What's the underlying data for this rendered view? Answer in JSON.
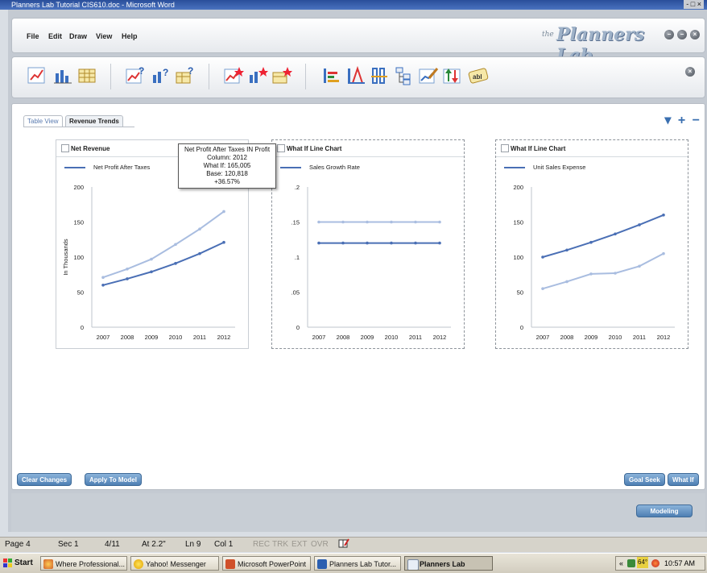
{
  "word_window": {
    "title": "Planners Lab Tutorial CIS610.doc - Microsoft Word",
    "controls": "- □ ×"
  },
  "app": {
    "menu": [
      "File",
      "Edit",
      "Draw",
      "View",
      "Help"
    ],
    "brand_prefix": "the",
    "brand_name": "Planners Lab",
    "window_buttons": [
      "−",
      "−",
      "×"
    ],
    "toolbar_icons": [
      "line-chart-icon",
      "bar-chart-icon",
      "table-icon",
      "line-chart-question-icon",
      "bar-chart-question-icon",
      "table-question-icon",
      "line-chart-star-icon",
      "bar-chart-star-icon",
      "table-star-icon",
      "bar-sort-icon",
      "range-icon",
      "column-split-icon",
      "tree-icon",
      "edit-chart-icon",
      "up-down-icon",
      "text-label-icon"
    ],
    "toolbar_close": "×",
    "tabs": [
      "Table View",
      "Revenue Trends"
    ],
    "tab_active": "Revenue Trends",
    "workspace_controls": "▾ + −",
    "buttons": {
      "clear": "Clear Changes",
      "apply": "Apply To Model",
      "goal_seek": "Goal Seek",
      "what_if": "What If",
      "modeling": "Modeling"
    }
  },
  "panels": [
    {
      "title": "Net Revenue",
      "legend": "Net Profit After Taxes"
    },
    {
      "title": "What If Line Chart",
      "legend": "Sales Growth Rate"
    },
    {
      "title": "What If Line Chart",
      "legend": "Unit Sales Expense"
    }
  ],
  "tooltip": {
    "line1": "Net Profit After Taxes IN Profit",
    "line2": "Column: 2012",
    "line3": "What If: 165,005",
    "line4": "Base: 120,818",
    "line5": "+36.57%"
  },
  "chart_data": [
    {
      "type": "line",
      "title": "Net Revenue",
      "ylabel": "In Thousands",
      "x": [
        "2007",
        "2008",
        "2009",
        "2010",
        "2011",
        "2012"
      ],
      "yticks": [
        "0",
        "50",
        "100",
        "150",
        "200"
      ],
      "ylim": [
        0,
        200
      ],
      "series": [
        {
          "name": "Net Profit After Taxes",
          "values": [
            60,
            69,
            79,
            91,
            105,
            121
          ],
          "color": "#4a6fb5"
        },
        {
          "values": [
            71,
            83,
            97,
            118,
            140,
            165
          ],
          "color": "#a9bde0"
        }
      ]
    },
    {
      "type": "line",
      "title": "What If Line Chart",
      "x": [
        "2007",
        "2008",
        "2009",
        "2010",
        "2011",
        "2012"
      ],
      "yticks": [
        "0",
        ".05",
        ".1",
        ".15",
        ".2"
      ],
      "ylim": [
        0,
        0.2
      ],
      "series": [
        {
          "name": "Sales Growth Rate",
          "values": [
            0.12,
            0.12,
            0.12,
            0.12,
            0.12,
            0.12
          ],
          "color": "#4a6fb5"
        },
        {
          "values": [
            0.15,
            0.15,
            0.15,
            0.15,
            0.15,
            0.15
          ],
          "color": "#a9bde0"
        }
      ]
    },
    {
      "type": "line",
      "title": "What If Line Chart",
      "x": [
        "2007",
        "2008",
        "2009",
        "2010",
        "2011",
        "2012"
      ],
      "yticks": [
        "0",
        "50",
        "100",
        "150",
        "200"
      ],
      "ylim": [
        0,
        200
      ],
      "series": [
        {
          "name": "Unit Sales Expense",
          "values": [
            100,
            110,
            121,
            133,
            146,
            160
          ],
          "color": "#4a6fb5"
        },
        {
          "values": [
            55,
            65,
            76,
            77,
            87,
            105
          ],
          "color": "#a9bde0"
        }
      ]
    }
  ],
  "word_status": {
    "page": "Page 4",
    "sec": "Sec 1",
    "pages": "4/11",
    "at": "At 2.2\"",
    "ln": "Ln 9",
    "col": "Col 1",
    "rec": "REC",
    "trk": "TRK",
    "ext": "EXT",
    "ovr": "OVR"
  },
  "taskbar": {
    "start": "Start",
    "items": [
      "Where Professional...",
      "Yahoo! Messenger",
      "Microsoft PowerPoint",
      "Planners Lab Tutor...",
      "Planners Lab"
    ],
    "tray_prefix": "«",
    "temp": "64°",
    "clock": "10:57 AM"
  }
}
